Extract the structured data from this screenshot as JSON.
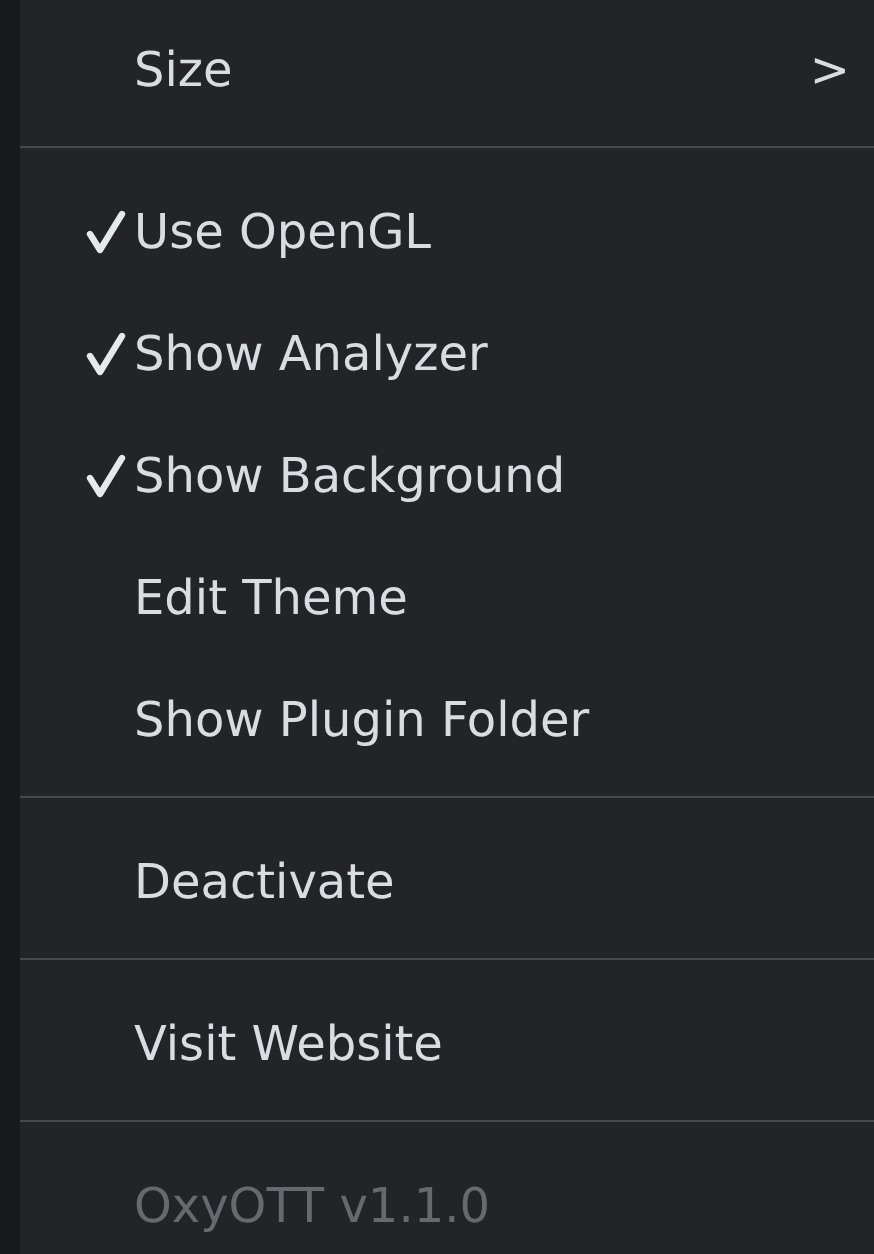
{
  "menu": {
    "items": [
      {
        "kind": "submenu",
        "label": "Size",
        "arrow": ">"
      },
      {
        "kind": "separator"
      },
      {
        "kind": "item",
        "label": "Use OpenGL",
        "checked": true,
        "disabled": false
      },
      {
        "kind": "item",
        "label": "Show Analyzer",
        "checked": true,
        "disabled": false
      },
      {
        "kind": "item",
        "label": "Show Background",
        "checked": true,
        "disabled": false
      },
      {
        "kind": "item",
        "label": "Edit Theme",
        "checked": false,
        "disabled": false
      },
      {
        "kind": "item",
        "label": "Show Plugin Folder",
        "checked": false,
        "disabled": false
      },
      {
        "kind": "separator"
      },
      {
        "kind": "item",
        "label": "Deactivate",
        "checked": false,
        "disabled": false
      },
      {
        "kind": "separator"
      },
      {
        "kind": "item",
        "label": "Visit Website",
        "checked": false,
        "disabled": false
      },
      {
        "kind": "separator"
      },
      {
        "kind": "item",
        "label": "OxyOTT v1.1.0",
        "checked": false,
        "disabled": true
      }
    ]
  }
}
